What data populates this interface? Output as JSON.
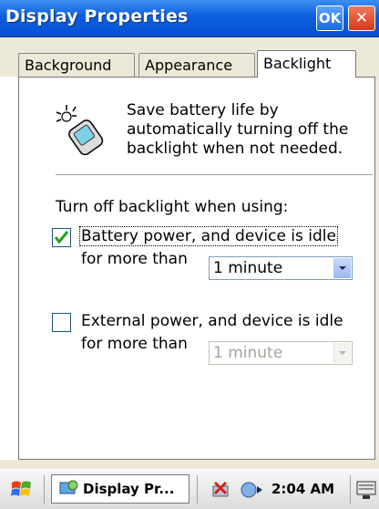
{
  "window": {
    "title": "Display Properties",
    "ok_label": "OK",
    "close_label": "✕"
  },
  "tabs": [
    {
      "label": "Background",
      "active": false
    },
    {
      "label": "Appearance",
      "active": false
    },
    {
      "label": "Backlight",
      "active": true
    }
  ],
  "backlight": {
    "info_line1": "Save battery life by",
    "info_line2": "automatically turning off the",
    "info_line3": "backlight when not needed.",
    "section_label": "Turn off backlight when using:",
    "battery": {
      "checked": true,
      "label_line1": "Battery power, and device is idle",
      "label_line2": "for more than",
      "timeout_value": "1 minute"
    },
    "external": {
      "checked": false,
      "label_line1": "External power, and device is idle",
      "label_line2": "for more than",
      "timeout_value": "1 minute",
      "timeout_enabled": false
    }
  },
  "taskbar": {
    "task_label": "Display Pr...",
    "clock": "2:04 AM"
  },
  "colors": {
    "titlebar": "#0a5fe0",
    "checkmark": "#1fa01f",
    "dialog_bg": "#ece9d8"
  }
}
